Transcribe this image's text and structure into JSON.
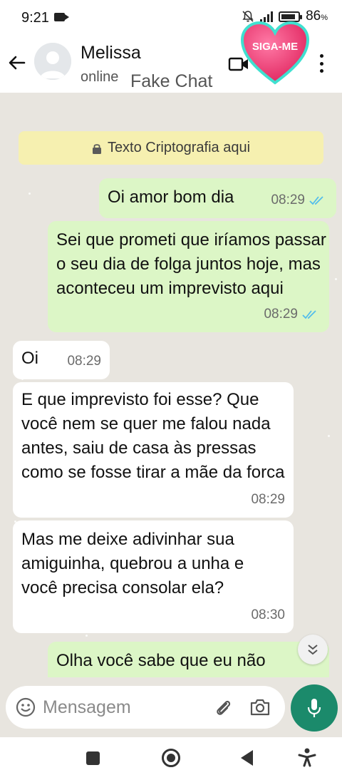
{
  "status_bar": {
    "time": "9:21",
    "battery": "86",
    "battery_unit": "%",
    "battery_level": 0.86
  },
  "header": {
    "contact_name": "Melissa",
    "status": "online",
    "overlay_label": "Fake Chat",
    "badge_text": "SIGA-ME",
    "badge_color": "#ef3b7a"
  },
  "system_message": "Texto Criptografia aqui",
  "messages": [
    {
      "direction": "out",
      "text": "Oi amor bom dia",
      "time": "08:29",
      "read": true
    },
    {
      "direction": "out",
      "text": "Sei que prometi que iríamos passar o seu dia de folga juntos hoje, mas aconteceu um imprevisto aqui",
      "time": "08:29",
      "read": true
    },
    {
      "direction": "in",
      "text": "Oi",
      "time": "08:29"
    },
    {
      "direction": "in",
      "text": "E que imprevisto foi esse? Que você nem se quer me falou nada antes, saiu de casa às pressas como se fosse tirar a mãe da forca",
      "time": "08:29"
    },
    {
      "direction": "in",
      "text": "Mas me deixe adivinhar sua amiguinha, quebrou a unha e você precisa consolar ela?",
      "time": "08:30"
    },
    {
      "direction": "out",
      "text": "Olha você sabe que eu não",
      "time": ""
    }
  ],
  "input": {
    "placeholder": "Mensagem"
  },
  "colors": {
    "outgoing_bubble": "#dcf6c6",
    "incoming_bubble": "#ffffff",
    "chat_background": "#e8e5df",
    "system_banner": "#f6f0b0",
    "read_ticks": "#53bdeb",
    "mic_button": "#1b8a6b"
  }
}
